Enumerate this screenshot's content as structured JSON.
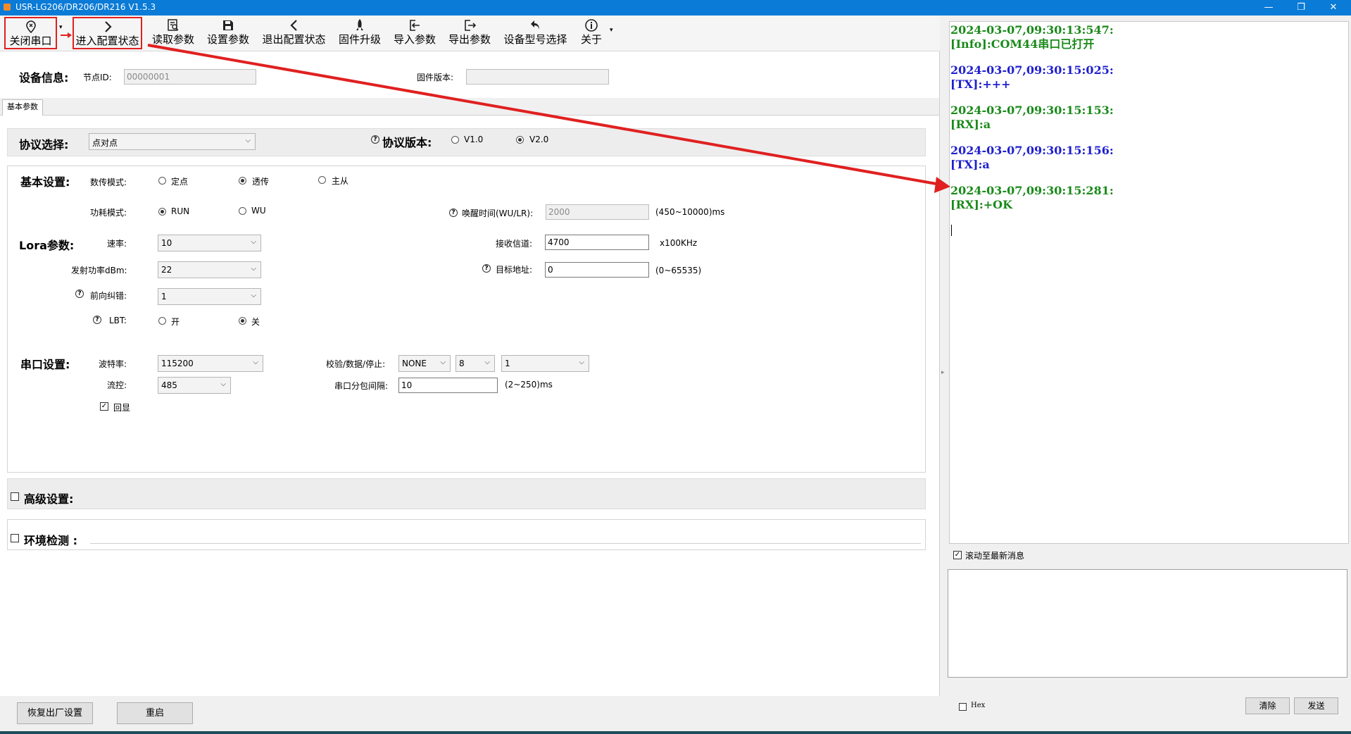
{
  "window": {
    "title": "USR-LG206/DR206/DR216 V1.5.3",
    "minimize": "—",
    "maximize": "❐",
    "close": "✕"
  },
  "toolbar": {
    "close_port": "关闭串口",
    "enter_config": "进入配置状态",
    "read_params": "读取参数",
    "set_params": "设置参数",
    "exit_config": "退出配置状态",
    "firmware_upgrade": "固件升级",
    "import_params": "导入参数",
    "export_params": "导出参数",
    "model_select": "设备型号选择",
    "about": "关于",
    "dropdown": "▾"
  },
  "device_info": {
    "heading": "设备信息:",
    "node_id_label": "节点ID:",
    "node_id_value": "00000001",
    "fw_version_label": "固件版本:",
    "fw_version_value": ""
  },
  "tab": {
    "basic": "基本参数"
  },
  "protocol": {
    "heading": "协议选择:",
    "selected": "点对点",
    "version_label": "协议版本:",
    "v1": "V1.0",
    "v2": "V2.0",
    "selected_version": "V2.0"
  },
  "basic": {
    "heading": "基本设置:",
    "transfer_mode_label": "数传模式:",
    "mode_fixed": "定点",
    "mode_transparent": "透传",
    "mode_master_slave": "主从",
    "selected_mode": "透传",
    "power_mode_label": "功耗模式:",
    "pm_run": "RUN",
    "pm_wu": "WU",
    "selected_power": "RUN",
    "wake_label": "唤醒时间(WU/LR):",
    "wake_value": "2000",
    "wake_range": "(450~10000)ms"
  },
  "lora": {
    "heading": "Lora参数:",
    "rate_label": "速率:",
    "rate_value": "10",
    "channel_label": "接收信道:",
    "channel_value": "4700",
    "channel_unit": "x100KHz",
    "power_label": "发射功率dBm:",
    "power_value": "22",
    "target_label": "目标地址:",
    "target_value": "0",
    "target_range": "(0~65535)",
    "fec_label": "前向纠错:",
    "fec_value": "1",
    "lbt_label": "LBT:",
    "lbt_on": "开",
    "lbt_off": "关",
    "lbt_selected": "关"
  },
  "serial": {
    "heading": "串口设置:",
    "baud_label": "波特率:",
    "baud_value": "115200",
    "parity_label": "校验/数据/停止:",
    "parity_value": "NONE",
    "data_value": "8",
    "stop_value": "1",
    "flow_label": "流控:",
    "flow_value": "485",
    "packet_label": "串口分包间隔:",
    "packet_value": "10",
    "packet_range": "(2~250)ms",
    "echo_label": "回显",
    "echo_checked": true
  },
  "advanced": {
    "label": "高级设置:"
  },
  "env": {
    "label": "环境检测 :"
  },
  "bottom": {
    "factory_reset": "恢复出厂设置",
    "restart": "重启"
  },
  "log": {
    "entries": [
      {
        "time": "2024-03-07,09:30:13:547:",
        "msg": "[Info]:COM44串口已打开",
        "color": "#1a8a1a"
      },
      {
        "time": "2024-03-07,09:30:15:025:",
        "msg": "[TX]:+++",
        "color": "#2020d0"
      },
      {
        "time": "2024-03-07,09:30:15:153:",
        "msg": "[RX]:a",
        "color": "#1a8a1a"
      },
      {
        "time": "2024-03-07,09:30:15:156:",
        "msg": "[TX]:a",
        "color": "#2020d0"
      },
      {
        "time": "2024-03-07,09:30:15:281:",
        "msg": "[RX]:+OK",
        "color": "#1a8a1a"
      }
    ],
    "scroll_latest": "滚动至最新消息",
    "hex_label": "Hex",
    "clear": "清除",
    "send": "发送"
  },
  "colors": {
    "accent": "#0a7bd6",
    "highlight": "#e02020"
  }
}
